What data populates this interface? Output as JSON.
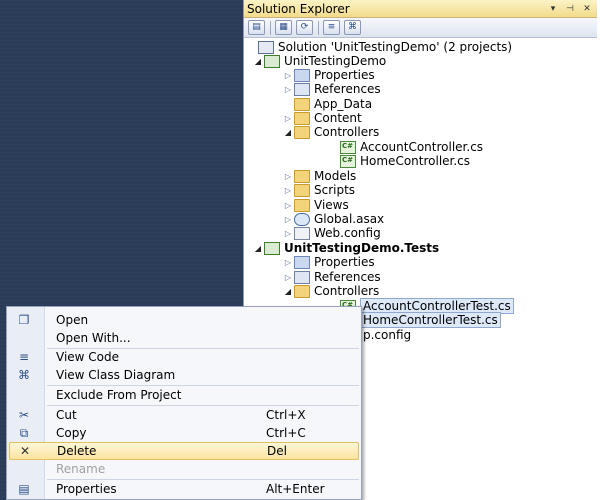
{
  "panel": {
    "title": "Solution Explorer",
    "title_buttons": [
      "▾",
      "⊣",
      "✕"
    ],
    "toolbar_icons": [
      "properties-icon",
      "show-all-files-icon",
      "refresh-icon",
      "view-code-icon",
      "class-diagram-icon"
    ]
  },
  "tree": [
    {
      "label": "Solution 'UnitTestingDemo' (2 projects)",
      "icon": "solution-icon",
      "expander": ""
    },
    {
      "label": "UnitTestingDemo",
      "icon": "project-icon",
      "expander": "◢"
    },
    {
      "label": "Properties",
      "icon": "properties-icon",
      "expander": "▷"
    },
    {
      "label": "References",
      "icon": "references-icon",
      "expander": "▷"
    },
    {
      "label": "App_Data",
      "icon": "folder-icon",
      "expander": ""
    },
    {
      "label": "Content",
      "icon": "folder-icon",
      "expander": "▷"
    },
    {
      "label": "Controllers",
      "icon": "folder-icon",
      "expander": "◢"
    },
    {
      "label": "AccountController.cs",
      "icon": "csharp-file-icon",
      "expander": ""
    },
    {
      "label": "HomeController.cs",
      "icon": "csharp-file-icon",
      "expander": ""
    },
    {
      "label": "Models",
      "icon": "folder-icon",
      "expander": "▷"
    },
    {
      "label": "Scripts",
      "icon": "folder-icon",
      "expander": "▷"
    },
    {
      "label": "Views",
      "icon": "folder-icon",
      "expander": "▷"
    },
    {
      "label": "Global.asax",
      "icon": "global-asax-icon",
      "expander": "▷"
    },
    {
      "label": "Web.config",
      "icon": "config-file-icon",
      "expander": "▷"
    },
    {
      "label": "UnitTestingDemo.Tests",
      "icon": "test-project-icon",
      "expander": "◢"
    },
    {
      "label": "Properties",
      "icon": "properties-icon",
      "expander": "▷"
    },
    {
      "label": "References",
      "icon": "references-icon",
      "expander": "▷"
    },
    {
      "label": "Controllers",
      "icon": "folder-icon",
      "expander": "◢"
    },
    {
      "label": "AccountControllerTest.cs",
      "icon": "csharp-file-icon",
      "expander": ""
    },
    {
      "label": "HomeControllerTest.cs",
      "icon": "csharp-file-icon",
      "expander": ""
    },
    {
      "label": "p.config",
      "icon": "config-file-icon",
      "expander": ""
    }
  ],
  "context_menu": {
    "items": [
      {
        "label": "Open",
        "shortcut": "",
        "icon": "open-icon"
      },
      {
        "label": "Open With...",
        "shortcut": "",
        "icon": ""
      },
      {
        "label": "View Code",
        "shortcut": "",
        "icon": "view-code-icon"
      },
      {
        "label": "View Class Diagram",
        "shortcut": "",
        "icon": "class-diagram-icon"
      },
      {
        "label": "Exclude From Project",
        "shortcut": "",
        "icon": ""
      },
      {
        "label": "Cut",
        "shortcut": "Ctrl+X",
        "icon": "cut-icon"
      },
      {
        "label": "Copy",
        "shortcut": "Ctrl+C",
        "icon": "copy-icon"
      },
      {
        "label": "Delete",
        "shortcut": "Del",
        "icon": "delete-icon"
      },
      {
        "label": "Rename",
        "shortcut": "",
        "icon": ""
      },
      {
        "label": "Properties",
        "shortcut": "Alt+Enter",
        "icon": "properties-icon"
      }
    ]
  }
}
